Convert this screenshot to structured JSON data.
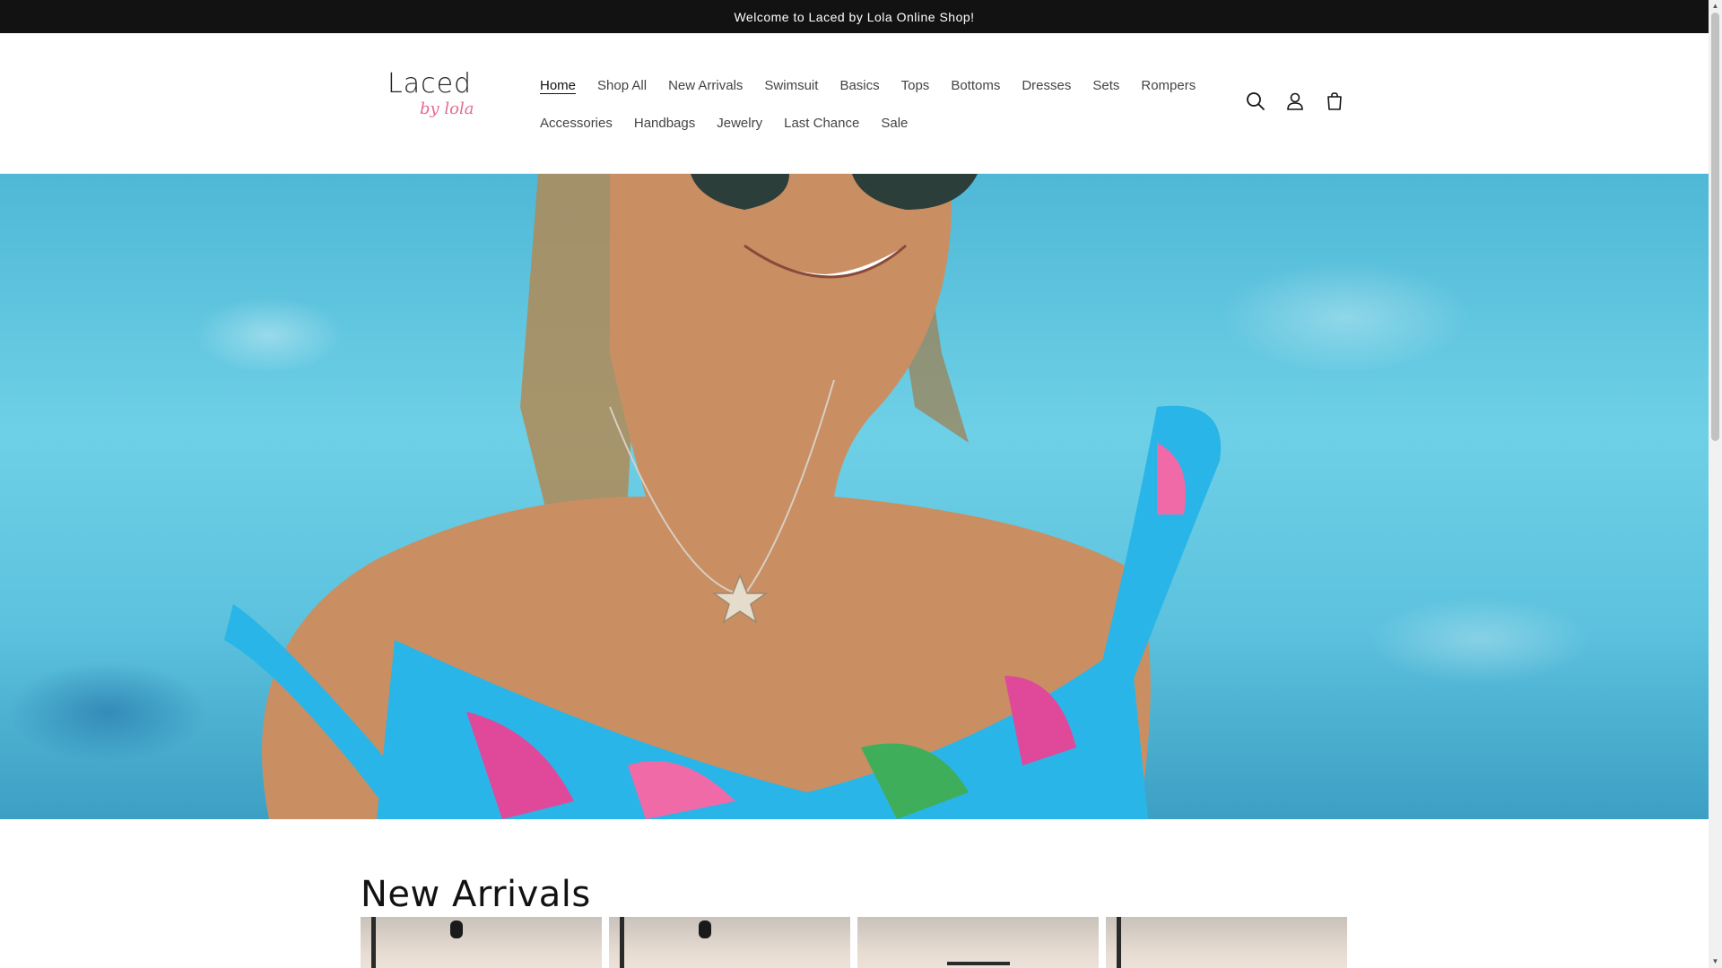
{
  "announcement": "Welcome to Laced by Lola Online Shop!",
  "logo": {
    "line1": "Laced",
    "line2": "by lola"
  },
  "nav": {
    "row1": [
      "Home",
      "Shop All",
      "New Arrivals",
      "Swimsuit",
      "Basics",
      "Tops",
      "Bottoms",
      "Dresses",
      "Sets",
      "Rompers"
    ],
    "row2": [
      "Accessories",
      "Handbags",
      "Jewelry",
      "Last Chance",
      "Sale"
    ],
    "active": "Home"
  },
  "icons": {
    "search": "search-icon",
    "account": "account-icon",
    "cart": "cart-icon"
  },
  "section": {
    "title": "New Arrivals"
  },
  "colors": {
    "announcement_bg": "#121212",
    "logo_accent": "#e66a8d",
    "hero_water": "#5cc2de"
  }
}
